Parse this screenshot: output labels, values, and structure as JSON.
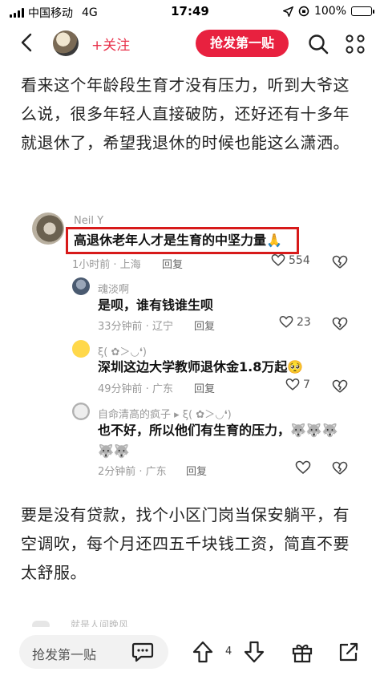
{
  "status_bar": {
    "carrier": "中国移动",
    "network": "4G",
    "time": "17:49",
    "battery": "100%"
  },
  "nav": {
    "follow_label": "+关注",
    "grab_label": "抢发第一贴"
  },
  "post": {
    "paragraph1": "看来这个年龄段生育才没有压力，听到大爷这么说，很多年轻人直接破防，还好还有十多年就退休了，希望我退休的时候也能这么潇洒。",
    "paragraph2": "要是没有贷款，找个小区门岗当保安躺平，有空调吹，每个月还四五千块钱工资，简直不要太舒服。"
  },
  "comments": {
    "main": {
      "name": "Neil Y",
      "text": "高退休老年人才是生育的中坚力量🙏",
      "time": "1小时前 · 上海",
      "reply": "回复",
      "likes": "554"
    },
    "replies": [
      {
        "name": "魂淡啊",
        "text": "是呗，谁有钱谁生呗",
        "time": "33分钟前 · 辽宁",
        "reply": "回复",
        "likes": "23"
      },
      {
        "name": "ξ( ✿＞◡❛)",
        "text": "深圳这边大学教师退休金1.8万起🥺",
        "time": "49分钟前 · 广东",
        "reply": "回复",
        "likes": "7"
      },
      {
        "name": "自命清高的疯子 ▸ ξ( ✿＞◡❛)",
        "text": "也不好，所以他们有生育的压力，🐺🐺🐺🐺🐺",
        "time": "2分钟前 · 广东",
        "reply": "回复",
        "likes": ""
      }
    ]
  },
  "next_comment_hint": "就是人间晚风",
  "bottom_bar": {
    "input_placeholder": "抢发第一贴",
    "vote_count": "4"
  },
  "colors": {
    "accent": "#e8213f",
    "highlight": "#d71a1a"
  }
}
